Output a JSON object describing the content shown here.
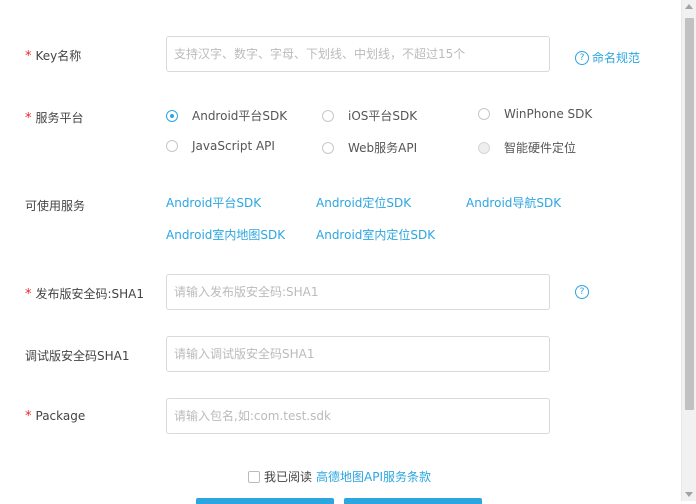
{
  "form": {
    "key_name": {
      "required": "*",
      "label": "Key名称",
      "placeholder": "支持汉字、数字、字母、下划线、中划线，不超过15个",
      "help": "命名规范"
    },
    "platform": {
      "required": "*",
      "label": "服务平台",
      "options": [
        {
          "label": "Android平台SDK",
          "state": "checked"
        },
        {
          "label": "iOS平台SDK",
          "state": "unchecked"
        },
        {
          "label": "WinPhone SDK",
          "state": "unchecked"
        },
        {
          "label": "JavaScript API",
          "state": "unchecked"
        },
        {
          "label": "Web服务API",
          "state": "unchecked"
        },
        {
          "label": "智能硬件定位",
          "state": "disabled"
        }
      ]
    },
    "services": {
      "label": "可使用服务",
      "items": [
        "Android平台SDK",
        "Android定位SDK",
        "Android导航SDK",
        "Android室内地图SDK",
        "Android室内定位SDK"
      ]
    },
    "release_sha1": {
      "required": "*",
      "label": "发布版安全码:SHA1",
      "placeholder": "请输入发布版安全码:SHA1",
      "help_icon": "question-circle-icon"
    },
    "debug_sha1": {
      "label": "调试版安全码SHA1",
      "placeholder": "请输入调试版安全码SHA1"
    },
    "package": {
      "required": "*",
      "label": "Package",
      "placeholder": "请输入包名,如:com.test.sdk"
    },
    "agreement": {
      "text": "我已阅读",
      "link": "高德地图API服务条款"
    }
  },
  "colors": {
    "accent": "#2ca6e0",
    "required": "#ee2233",
    "border": "#d9d9d9"
  }
}
